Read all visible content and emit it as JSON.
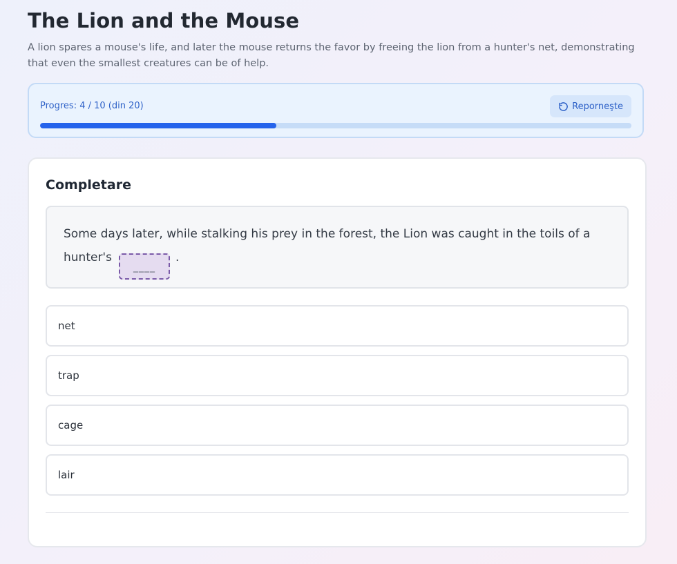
{
  "header": {
    "title": "The Lion and the Mouse",
    "description": "A lion spares a mouse's life, and later the mouse returns the favor by freeing the lion from a hunter's net, demonstrating that even the smallest creatures can be of help."
  },
  "progress": {
    "label": "Progres: 4 / 10 (din 20)",
    "current": 4,
    "total": 10,
    "fraction": 0.4,
    "restart_label": "Reporneşte",
    "restart_icon": "restart-icon"
  },
  "exercise": {
    "heading": "Completare",
    "sentence_before": "Some days later, while stalking his prey in the forest, the Lion was caught in the toils of a hunter's",
    "blank": "____",
    "sentence_after": ".",
    "options": [
      "net",
      "trap",
      "cage",
      "lair"
    ]
  },
  "colors": {
    "accent": "#2563eb",
    "progress_track": "#c6dcf7",
    "blank_border": "#7a5aa8",
    "blank_fill": "#e5dcf0"
  }
}
